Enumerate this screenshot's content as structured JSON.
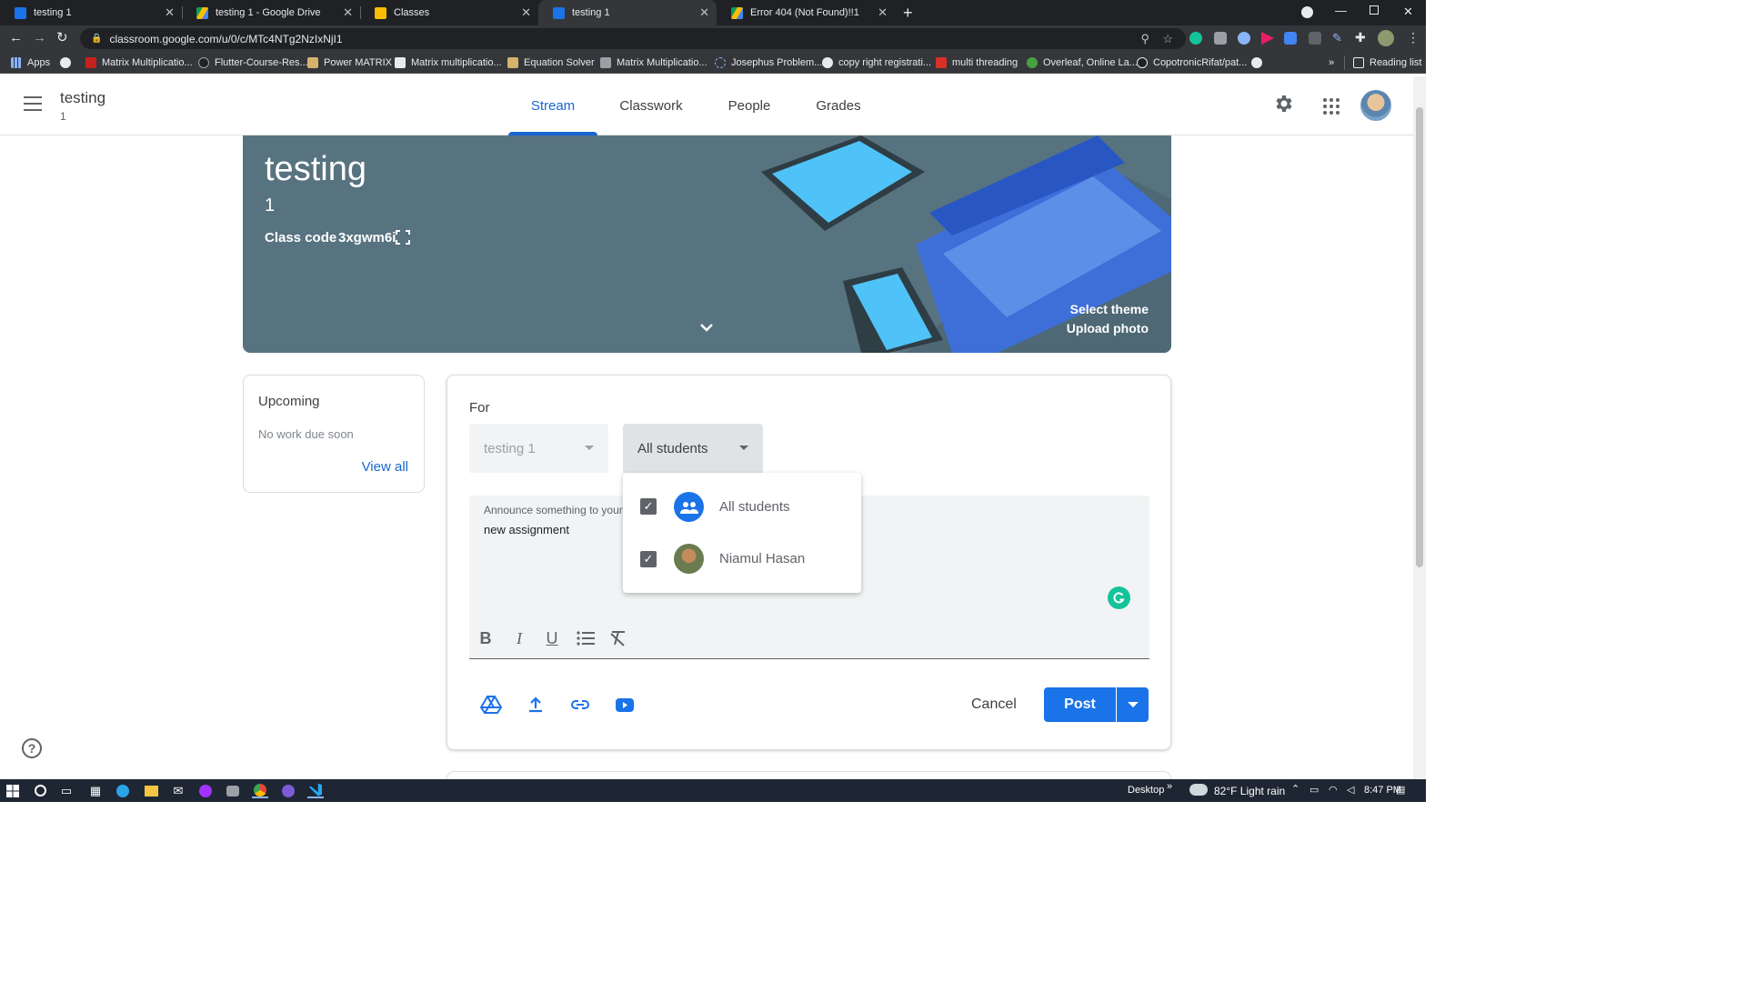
{
  "browser": {
    "tabs": [
      {
        "title": "testing 1",
        "active": false
      },
      {
        "title": "testing 1 - Google Drive",
        "active": false
      },
      {
        "title": "Classes",
        "active": false
      },
      {
        "title": "testing 1",
        "active": true
      },
      {
        "title": "Error 404 (Not Found)!!1",
        "active": false
      }
    ],
    "url": "classroom.google.com/u/0/c/MTc4NTg2NzIxNjI1",
    "bookmarks": [
      "Apps",
      "Matrix Multiplicatio...",
      "Flutter-Course-Res...",
      "Power MATRIX",
      "Matrix multiplicatio...",
      "Equation Solver",
      "Matrix Multiplicatio...",
      "Josephus Problem...",
      "copy right registrati...",
      "multi threading",
      "Overleaf, Online La...",
      "CopotronicRifat/pat..."
    ],
    "reading_list": "Reading list"
  },
  "header": {
    "class_name": "testing",
    "section": "1",
    "tabs": [
      "Stream",
      "Classwork",
      "People",
      "Grades"
    ],
    "active_tab": "Stream"
  },
  "banner": {
    "title": "testing",
    "section": "1",
    "class_code_label": "Class code",
    "class_code": "3xgwm6i",
    "select_theme": "Select theme",
    "upload_photo": "Upload photo"
  },
  "upcoming": {
    "title": "Upcoming",
    "empty_text": "No work due soon",
    "view_all": "View all"
  },
  "composer": {
    "for_label": "For",
    "class_select": "testing 1",
    "audience_select": "All students",
    "placeholder": "Announce something to your cl",
    "text": "new assignment",
    "cancel": "Cancel",
    "post": "Post"
  },
  "audience_menu": [
    {
      "label": "All students",
      "checked": true
    },
    {
      "label": "Niamul Hasan",
      "checked": true
    }
  ],
  "taskbar": {
    "desktop": "Desktop",
    "weather": "82°F  Light rain",
    "time": "8:47 PM"
  },
  "colors": {
    "accent": "#1967d2",
    "post_button": "#1a73e8",
    "banner": "#587380"
  }
}
